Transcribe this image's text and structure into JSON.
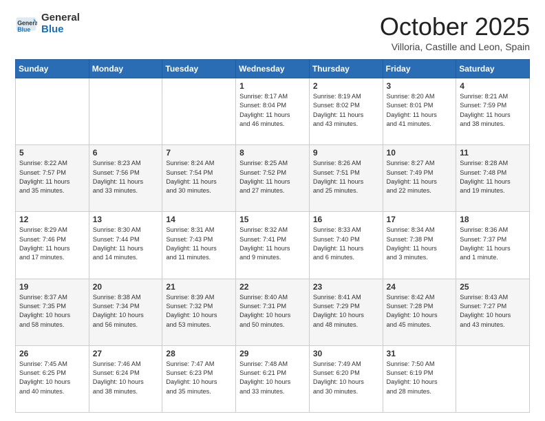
{
  "logo": {
    "general": "General",
    "blue": "Blue"
  },
  "header": {
    "month_title": "October 2025",
    "subtitle": "Villoria, Castille and Leon, Spain"
  },
  "weekdays": [
    "Sunday",
    "Monday",
    "Tuesday",
    "Wednesday",
    "Thursday",
    "Friday",
    "Saturday"
  ],
  "weeks": [
    [
      {
        "day": "",
        "info": ""
      },
      {
        "day": "",
        "info": ""
      },
      {
        "day": "",
        "info": ""
      },
      {
        "day": "1",
        "info": "Sunrise: 8:17 AM\nSunset: 8:04 PM\nDaylight: 11 hours\nand 46 minutes."
      },
      {
        "day": "2",
        "info": "Sunrise: 8:19 AM\nSunset: 8:02 PM\nDaylight: 11 hours\nand 43 minutes."
      },
      {
        "day": "3",
        "info": "Sunrise: 8:20 AM\nSunset: 8:01 PM\nDaylight: 11 hours\nand 41 minutes."
      },
      {
        "day": "4",
        "info": "Sunrise: 8:21 AM\nSunset: 7:59 PM\nDaylight: 11 hours\nand 38 minutes."
      }
    ],
    [
      {
        "day": "5",
        "info": "Sunrise: 8:22 AM\nSunset: 7:57 PM\nDaylight: 11 hours\nand 35 minutes."
      },
      {
        "day": "6",
        "info": "Sunrise: 8:23 AM\nSunset: 7:56 PM\nDaylight: 11 hours\nand 33 minutes."
      },
      {
        "day": "7",
        "info": "Sunrise: 8:24 AM\nSunset: 7:54 PM\nDaylight: 11 hours\nand 30 minutes."
      },
      {
        "day": "8",
        "info": "Sunrise: 8:25 AM\nSunset: 7:52 PM\nDaylight: 11 hours\nand 27 minutes."
      },
      {
        "day": "9",
        "info": "Sunrise: 8:26 AM\nSunset: 7:51 PM\nDaylight: 11 hours\nand 25 minutes."
      },
      {
        "day": "10",
        "info": "Sunrise: 8:27 AM\nSunset: 7:49 PM\nDaylight: 11 hours\nand 22 minutes."
      },
      {
        "day": "11",
        "info": "Sunrise: 8:28 AM\nSunset: 7:48 PM\nDaylight: 11 hours\nand 19 minutes."
      }
    ],
    [
      {
        "day": "12",
        "info": "Sunrise: 8:29 AM\nSunset: 7:46 PM\nDaylight: 11 hours\nand 17 minutes."
      },
      {
        "day": "13",
        "info": "Sunrise: 8:30 AM\nSunset: 7:44 PM\nDaylight: 11 hours\nand 14 minutes."
      },
      {
        "day": "14",
        "info": "Sunrise: 8:31 AM\nSunset: 7:43 PM\nDaylight: 11 hours\nand 11 minutes."
      },
      {
        "day": "15",
        "info": "Sunrise: 8:32 AM\nSunset: 7:41 PM\nDaylight: 11 hours\nand 9 minutes."
      },
      {
        "day": "16",
        "info": "Sunrise: 8:33 AM\nSunset: 7:40 PM\nDaylight: 11 hours\nand 6 minutes."
      },
      {
        "day": "17",
        "info": "Sunrise: 8:34 AM\nSunset: 7:38 PM\nDaylight: 11 hours\nand 3 minutes."
      },
      {
        "day": "18",
        "info": "Sunrise: 8:36 AM\nSunset: 7:37 PM\nDaylight: 11 hours\nand 1 minute."
      }
    ],
    [
      {
        "day": "19",
        "info": "Sunrise: 8:37 AM\nSunset: 7:35 PM\nDaylight: 10 hours\nand 58 minutes."
      },
      {
        "day": "20",
        "info": "Sunrise: 8:38 AM\nSunset: 7:34 PM\nDaylight: 10 hours\nand 56 minutes."
      },
      {
        "day": "21",
        "info": "Sunrise: 8:39 AM\nSunset: 7:32 PM\nDaylight: 10 hours\nand 53 minutes."
      },
      {
        "day": "22",
        "info": "Sunrise: 8:40 AM\nSunset: 7:31 PM\nDaylight: 10 hours\nand 50 minutes."
      },
      {
        "day": "23",
        "info": "Sunrise: 8:41 AM\nSunset: 7:29 PM\nDaylight: 10 hours\nand 48 minutes."
      },
      {
        "day": "24",
        "info": "Sunrise: 8:42 AM\nSunset: 7:28 PM\nDaylight: 10 hours\nand 45 minutes."
      },
      {
        "day": "25",
        "info": "Sunrise: 8:43 AM\nSunset: 7:27 PM\nDaylight: 10 hours\nand 43 minutes."
      }
    ],
    [
      {
        "day": "26",
        "info": "Sunrise: 7:45 AM\nSunset: 6:25 PM\nDaylight: 10 hours\nand 40 minutes."
      },
      {
        "day": "27",
        "info": "Sunrise: 7:46 AM\nSunset: 6:24 PM\nDaylight: 10 hours\nand 38 minutes."
      },
      {
        "day": "28",
        "info": "Sunrise: 7:47 AM\nSunset: 6:23 PM\nDaylight: 10 hours\nand 35 minutes."
      },
      {
        "day": "29",
        "info": "Sunrise: 7:48 AM\nSunset: 6:21 PM\nDaylight: 10 hours\nand 33 minutes."
      },
      {
        "day": "30",
        "info": "Sunrise: 7:49 AM\nSunset: 6:20 PM\nDaylight: 10 hours\nand 30 minutes."
      },
      {
        "day": "31",
        "info": "Sunrise: 7:50 AM\nSunset: 6:19 PM\nDaylight: 10 hours\nand 28 minutes."
      },
      {
        "day": "",
        "info": ""
      }
    ]
  ]
}
